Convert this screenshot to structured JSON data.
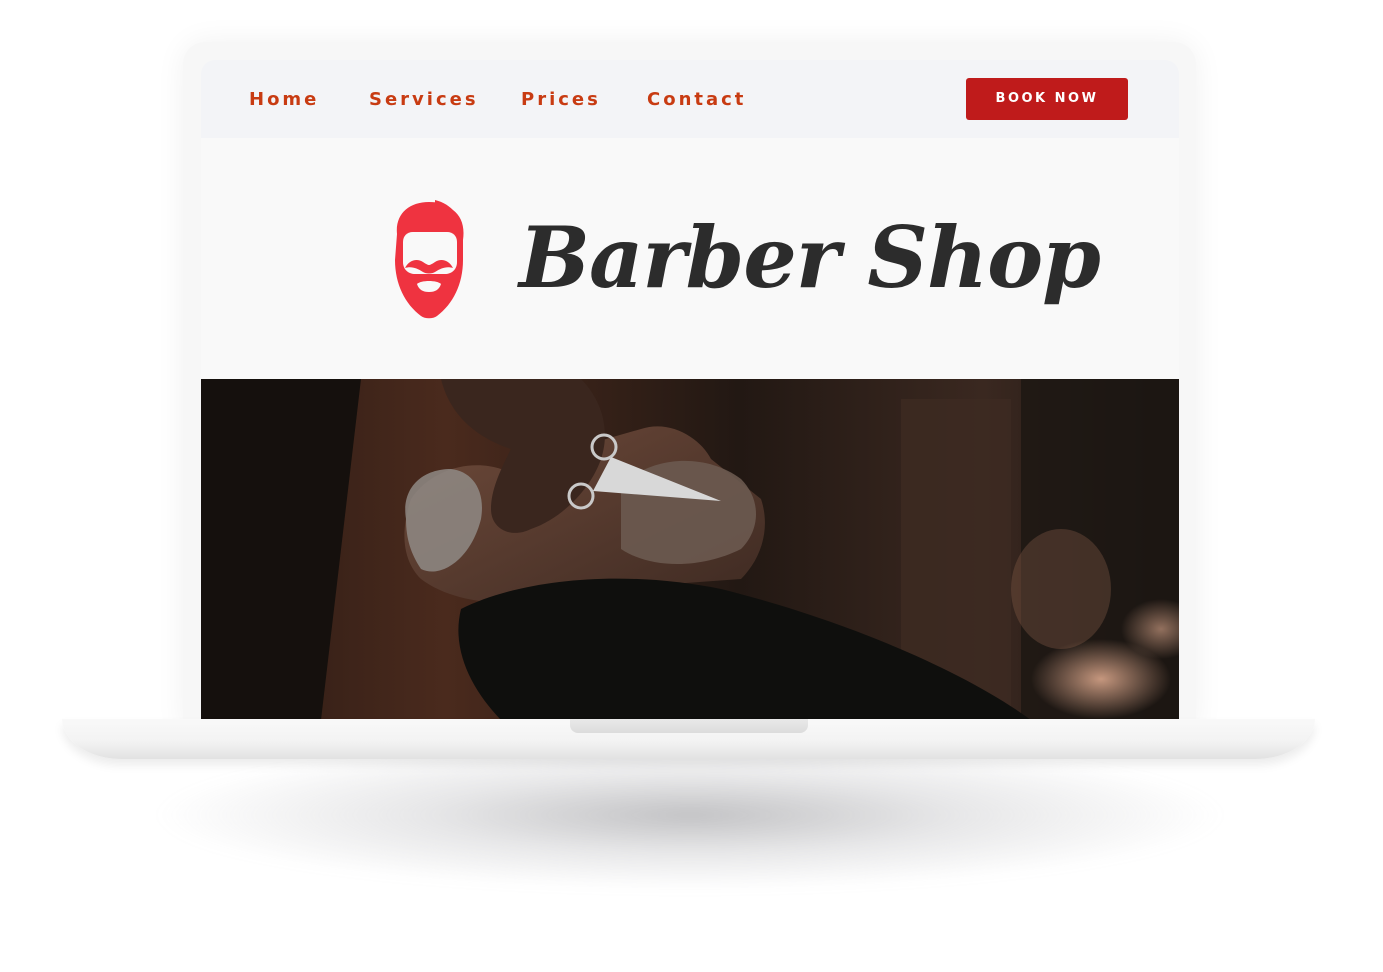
{
  "nav": {
    "links": [
      "Home",
      "Services",
      "Prices",
      "Contact"
    ],
    "book_label": "BOOK NOW"
  },
  "brand": {
    "name": "Barber Shop",
    "logo_icon": "bearded-man-head-icon"
  },
  "hero": {
    "image": "barber-trimming-beard-photo"
  },
  "colors": {
    "accent": "#c83b12",
    "button": "#bf1b1b",
    "logo": "#ef3340",
    "brand_text": "#2c2c2c",
    "nav_bg": "#f3f4f7"
  }
}
